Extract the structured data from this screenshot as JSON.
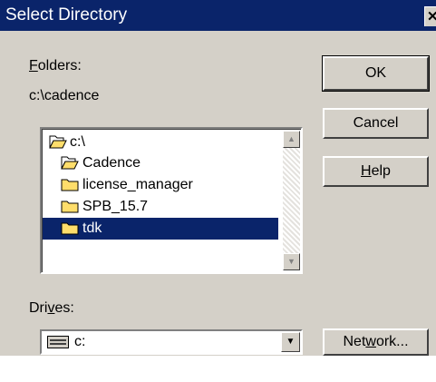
{
  "window": {
    "title": "Select Directory",
    "close_glyph": "✕"
  },
  "folders": {
    "label_prefix": "F",
    "label_rest": "olders:",
    "current_path": "c:\\cadence",
    "items": [
      {
        "label": "c:\\",
        "icon": "open-folder-icon",
        "selected": false
      },
      {
        "label": "Cadence",
        "icon": "open-folder-icon",
        "selected": false
      },
      {
        "label": "license_manager",
        "icon": "folder-icon",
        "selected": false
      },
      {
        "label": "SPB_15.7",
        "icon": "folder-icon",
        "selected": false
      },
      {
        "label": "tdk",
        "icon": "folder-icon",
        "selected": true
      }
    ]
  },
  "drives": {
    "label_pre": "Dri",
    "label_u": "v",
    "label_post": "es:",
    "value": "c:",
    "icon": "drive-icon"
  },
  "buttons": {
    "ok": "OK",
    "cancel": "Cancel",
    "help_u": "H",
    "help_rest": "elp",
    "network_pre": "Net",
    "network_u": "w",
    "network_post": "ork..."
  },
  "colors": {
    "selection": "#0a246a",
    "face": "#d4d0c8",
    "folder": "#ffde6b"
  }
}
